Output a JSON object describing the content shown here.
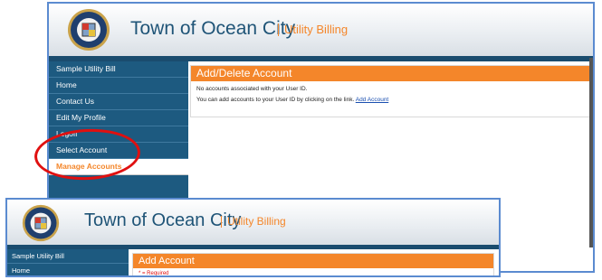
{
  "main": {
    "header": {
      "town": "Town of Ocean City",
      "separator": "|",
      "subtitle": "Utility Billing"
    },
    "sidebar": {
      "items": [
        {
          "label": "Sample Utility Bill"
        },
        {
          "label": "Home"
        },
        {
          "label": "Contact Us"
        },
        {
          "label": "Edit My Profile"
        },
        {
          "label": "Logoff"
        },
        {
          "label": "Select Account"
        },
        {
          "label": "Manage Accounts"
        }
      ]
    },
    "panel": {
      "title": "Add/Delete Account",
      "line1": "No accounts associated with your User ID.",
      "line2": "You can add accounts to your User ID by clicking on the link.",
      "link": "Add Account"
    }
  },
  "front": {
    "header": {
      "town": "Town of Ocean City",
      "separator": "|",
      "subtitle": "Utility Billing"
    },
    "sidebar": {
      "items": [
        {
          "label": "Sample Utility Bill"
        },
        {
          "label": "Home"
        }
      ]
    },
    "panel": {
      "title": "Add Account",
      "required": "* = Required"
    }
  },
  "colors": {
    "accent": "#f4862a",
    "nav": "#1d5a80",
    "brand_text": "#1f5477",
    "highlight": "#e01010",
    "frame": "#5b8bd0"
  },
  "icons": {
    "seal": "town-seal-icon"
  }
}
